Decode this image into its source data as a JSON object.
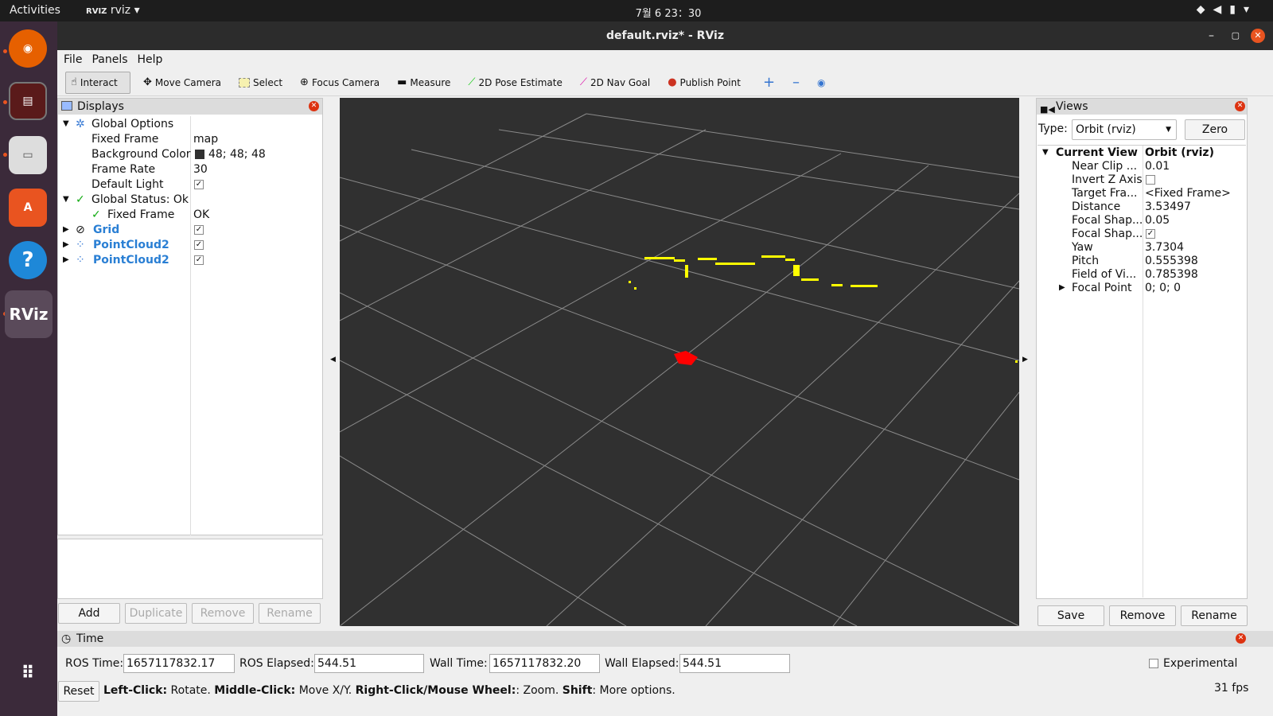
{
  "topbar": {
    "activities": "Activities",
    "app": "rviz",
    "clock": "7월 6  23：30"
  },
  "window": {
    "title": "default.rviz* - RViz"
  },
  "menu": [
    "File",
    "Panels",
    "Help"
  ],
  "toolbar": {
    "interact": "Interact",
    "move_camera": "Move Camera",
    "select": "Select",
    "focus_camera": "Focus Camera",
    "measure": "Measure",
    "pose_estimate": "2D Pose Estimate",
    "nav_goal": "2D Nav Goal",
    "publish_point": "Publish Point"
  },
  "displays": {
    "title": "Displays",
    "global_options": "Global Options",
    "fixed_frame_label": "Fixed Frame",
    "fixed_frame_value": "map",
    "bg_color_label": "Background Color",
    "bg_color_value": "48; 48; 48",
    "frame_rate_label": "Frame Rate",
    "frame_rate_value": "30",
    "default_light_label": "Default Light",
    "global_status": "Global Status: Ok",
    "status_fixed_frame": "Fixed Frame",
    "status_fixed_frame_value": "OK",
    "grid": "Grid",
    "pc1": "PointCloud2",
    "pc2": "PointCloud2",
    "add": "Add",
    "duplicate": "Duplicate",
    "remove": "Remove",
    "rename": "Rename"
  },
  "views": {
    "title": "Views",
    "type_label": "Type:",
    "type_value": "Orbit (rviz)",
    "zero": "Zero",
    "current_view": "Current View",
    "current_view_value": "Orbit (rviz)",
    "props": [
      {
        "k": "Near Clip ...",
        "v": "0.01"
      },
      {
        "k": "Invert Z Axis",
        "v": ""
      },
      {
        "k": "Target Fra...",
        "v": "<Fixed Frame>"
      },
      {
        "k": "Distance",
        "v": "3.53497"
      },
      {
        "k": "Focal Shap...",
        "v": "0.05"
      },
      {
        "k": "Focal Shap...",
        "v": ""
      },
      {
        "k": "Yaw",
        "v": "3.7304"
      },
      {
        "k": "Pitch",
        "v": "0.555398"
      },
      {
        "k": "Field of Vi...",
        "v": "0.785398"
      },
      {
        "k": "Focal Point",
        "v": "0; 0; 0"
      }
    ],
    "save": "Save",
    "remove": "Remove",
    "rename": "Rename"
  },
  "time": {
    "title": "Time",
    "ros_time_label": "ROS Time:",
    "ros_time": "1657117832.17",
    "ros_elapsed_label": "ROS Elapsed:",
    "ros_elapsed": "544.51",
    "wall_time_label": "Wall Time:",
    "wall_time": "1657117832.20",
    "wall_elapsed_label": "Wall Elapsed:",
    "wall_elapsed": "544.51",
    "experimental": "Experimental"
  },
  "status": {
    "reset": "Reset",
    "b1": "Left-Click:",
    "t1": " Rotate. ",
    "b2": "Middle-Click:",
    "t2": " Move X/Y. ",
    "b3": "Right-Click/Mouse Wheel:",
    "t3": ": Zoom. ",
    "b4": "Shift",
    "t4": ": More options.",
    "fps": "31 fps"
  },
  "colors": {
    "background": "#303030",
    "points": "#ffff00",
    "robot": "#ff0000"
  }
}
